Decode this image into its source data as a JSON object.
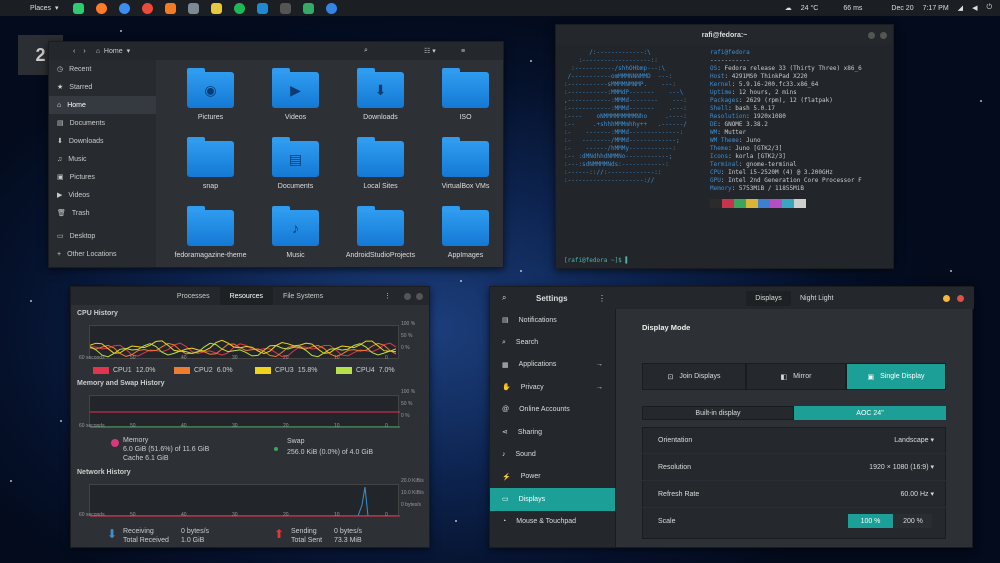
{
  "topbar": {
    "places": "Places",
    "weather": "24 °C",
    "ping": "66 ms",
    "date": "Dec 20",
    "time": "7:17 PM"
  },
  "workspace": {
    "number": "2"
  },
  "files": {
    "location": "Home",
    "sidebar": [
      "Recent",
      "Starred",
      "Home",
      "Documents",
      "Downloads",
      "Music",
      "Pictures",
      "Videos",
      "Trash",
      "Desktop",
      "Other Locations"
    ],
    "folders": [
      "Pictures",
      "Videos",
      "Downloads",
      "ISO",
      "snap",
      "Documents",
      "Local Sites",
      "VirtualBox VMs",
      "fedoramagazine-theme",
      "Music",
      "AndroidStudioProjects",
      "AppImages"
    ]
  },
  "terminal": {
    "title": "rafi@fedora:~",
    "ascii": "       /:-------------:\\\n    :-------------------::\n  :-----------/shhOHbmp---:\\\n /-----------omMMMNNNMMD  ---:\n:-----------sMMMMNMNMP.    ---:\n:-----------:MMMdP-------    ---\\\n,------------:MMMd--------    ---:\n:------------:MMMd-------    .---:\n:----    oNMMMMMMMMMNho     .----:\n:--     .+shhhMMMmhhy++   .------/\n:-    -------:MMMd--------------:\n:-   --------/MMMd-------------;\n:-    ------/hMMMy------------:\n:-- :dMNdhhdNMMNo------------;\n:---:sdNMMMMNds:------------:\n:------:://:-------------::\n:---------------------://",
    "user_host": "rafi@fedora",
    "separator": "-----------",
    "info": [
      {
        "k": "OS",
        "v": "Fedora release 33 (Thirty Three) x86_6"
      },
      {
        "k": "Host",
        "v": "4291MS0 ThinkPad X220"
      },
      {
        "k": "Kernel",
        "v": "5.9.16-200.fc33.x86_64"
      },
      {
        "k": "Uptime",
        "v": "12 hours, 2 mins"
      },
      {
        "k": "Packages",
        "v": "2629 (rpm), 12 (flatpak)"
      },
      {
        "k": "Shell",
        "v": "bash 5.0.17"
      },
      {
        "k": "Resolution",
        "v": "1920x1080"
      },
      {
        "k": "DE",
        "v": "GNOME 3.38.2"
      },
      {
        "k": "WM",
        "v": "Mutter"
      },
      {
        "k": "WM Theme",
        "v": "Juno"
      },
      {
        "k": "Theme",
        "v": "Juno [GTK2/3]"
      },
      {
        "k": "Icons",
        "v": "korla [GTK2/3]"
      },
      {
        "k": "Terminal",
        "v": "gnome-terminal"
      },
      {
        "k": "CPU",
        "v": "Intel i5-2520M (4) @ 3.200GHz"
      },
      {
        "k": "GPU",
        "v": "Intel 2nd Generation Core Processor F"
      },
      {
        "k": "Memory",
        "v": "5753MiB / 11855MiB"
      }
    ],
    "palette": [
      "#2b2b2b",
      "#c8344c",
      "#3ca55c",
      "#d8b535",
      "#3f7fd0",
      "#b34fc0",
      "#39a6c0",
      "#cfcfcf"
    ],
    "prompt": "[rafi@fedora ~]$ "
  },
  "monitor": {
    "tabs": [
      "Processes",
      "Resources",
      "File Systems"
    ],
    "cpu_title": "CPU History",
    "mem_title": "Memory and Swap History",
    "net_title": "Network History",
    "cpu_ticks": [
      "60 seconds",
      "50",
      "40",
      "30",
      "20",
      "10",
      "0"
    ],
    "cpu_pct": [
      "100 %",
      "50 %",
      "0 %"
    ],
    "net_rate": [
      "20.0 KiB/s",
      "10.0 KiB/s",
      "0 bytes/s"
    ],
    "cpus": [
      {
        "label": "CPU1",
        "value": "12.0%",
        "color": "#e3344f"
      },
      {
        "label": "CPU2",
        "value": "6.0%",
        "color": "#ef7c2e"
      },
      {
        "label": "CPU3",
        "value": "15.8%",
        "color": "#f2d21b"
      },
      {
        "label": "CPU4",
        "value": "7.0%",
        "color": "#b8e04a"
      }
    ],
    "memory": {
      "label": "Memory",
      "used": "6.0 GiB (51.6%) of 11.6 GiB",
      "cache": "Cache 6.1 GiB"
    },
    "swap": {
      "label": "Swap",
      "used": "256.0 KiB (0.0%) of 4.0 GiB"
    },
    "net": {
      "receiving": "Receiving",
      "recv_rate": "0 bytes/s",
      "total_received": "Total Received",
      "recv_total": "1.0 GiB",
      "sending": "Sending",
      "send_rate": "0 bytes/s",
      "total_sent": "Total Sent",
      "send_total": "73.3 MiB"
    }
  },
  "settings": {
    "title": "Settings",
    "tabs": [
      "Displays",
      "Night Light"
    ],
    "sidebar": [
      "Notifications",
      "Search",
      "Applications",
      "Privacy",
      "Online Accounts",
      "Sharing",
      "Sound",
      "Power",
      "Displays",
      "Mouse & Touchpad"
    ],
    "display_mode": "Display Mode",
    "modes": [
      "Join Displays",
      "Mirror",
      "Single Display"
    ],
    "monitors": [
      "Built-in display",
      "AOC 24\""
    ],
    "orientation": {
      "label": "Orientation",
      "value": "Landscape"
    },
    "resolution": {
      "label": "Resolution",
      "value": "1920 × 1080 (16:9)"
    },
    "refresh": {
      "label": "Refresh Rate",
      "value": "60.00 Hz"
    },
    "scale": {
      "label": "Scale",
      "options": [
        "100 %",
        "200 %"
      ]
    },
    "accent": "#1c9f96"
  }
}
